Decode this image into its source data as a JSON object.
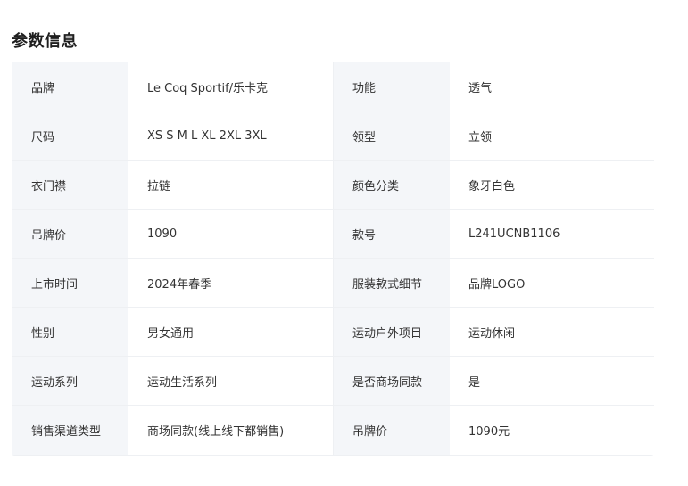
{
  "section": {
    "title": "参数信息"
  },
  "params": [
    [
      {
        "label": "品牌",
        "value": "Le Coq Sportif/乐卡克"
      },
      {
        "label": "功能",
        "value": "透气"
      }
    ],
    [
      {
        "label": "尺码",
        "value": "XS S M L XL 2XL 3XL"
      },
      {
        "label": "领型",
        "value": "立领"
      }
    ],
    [
      {
        "label": "衣门襟",
        "value": "拉链"
      },
      {
        "label": "颜色分类",
        "value": "象牙白色"
      }
    ],
    [
      {
        "label": "吊牌价",
        "value": "1090"
      },
      {
        "label": "款号",
        "value": "L241UCNB1106"
      }
    ],
    [
      {
        "label": "上市时间",
        "value": "2024年春季"
      },
      {
        "label": "服装款式细节",
        "value": "品牌LOGO"
      }
    ],
    [
      {
        "label": "性别",
        "value": "男女通用"
      },
      {
        "label": "运动户外项目",
        "value": "运动休闲"
      }
    ],
    [
      {
        "label": "运动系列",
        "value": "运动生活系列"
      },
      {
        "label": "是否商场同款",
        "value": "是"
      }
    ],
    [
      {
        "label": "销售渠道类型",
        "value": "商场同款(线上线下都销售)"
      },
      {
        "label": "吊牌价",
        "value": "1090元"
      }
    ]
  ],
  "colors": {
    "label_bg": "#f4f6f9",
    "border": "#eef0f3",
    "text": "#333333",
    "title": "#1f1f1f"
  }
}
